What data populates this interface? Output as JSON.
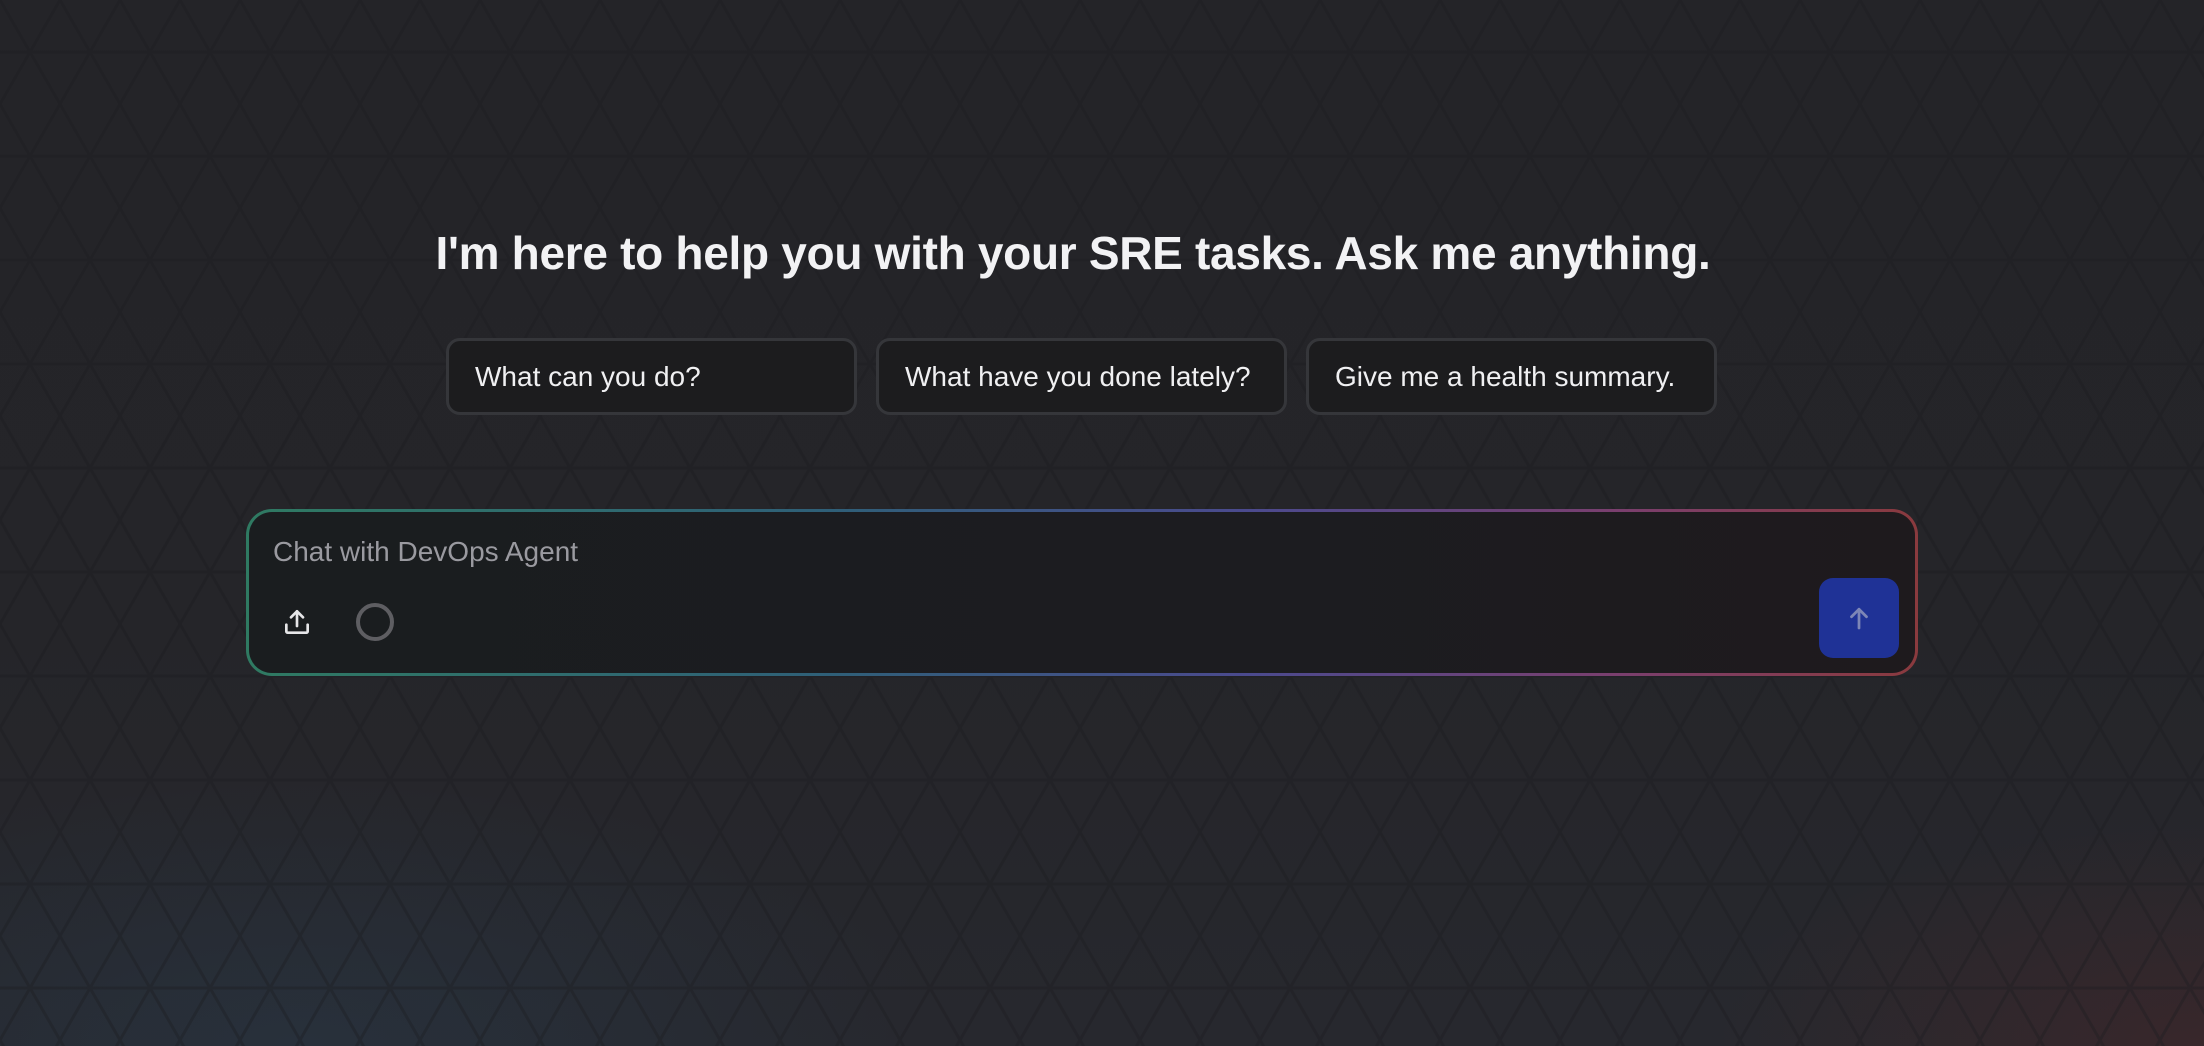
{
  "headline": "I'm here to help you with your SRE tasks. Ask me anything.",
  "suggestions": [
    {
      "label": "What can you do?"
    },
    {
      "label": "What have you done lately?"
    },
    {
      "label": "Give me a health summary."
    }
  ],
  "composer": {
    "placeholder": "Chat with DevOps Agent",
    "value": "",
    "icons": {
      "upload": "upload-icon",
      "status": "status-ring-icon",
      "send": "arrow-up-icon"
    }
  },
  "colors": {
    "background": "#232327",
    "send_button": "#1f3296",
    "gradient_border": [
      "#2f7a62",
      "#4b4a8e",
      "#8a3a3e"
    ]
  }
}
